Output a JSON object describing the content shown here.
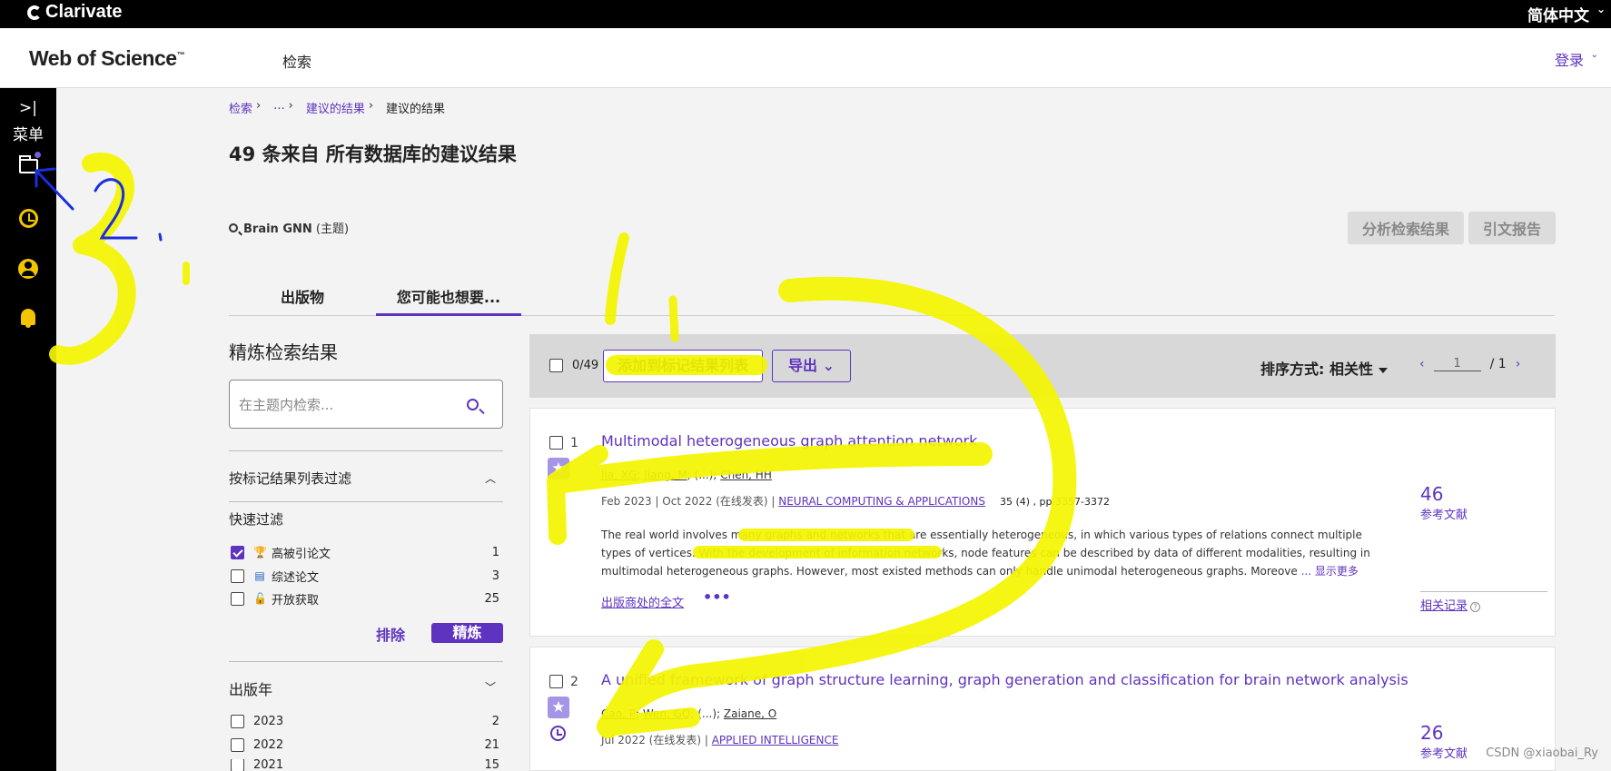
{
  "topbar": {
    "brand": "Clarivate",
    "language": "简体中文"
  },
  "header": {
    "product": "Web of Science",
    "trademark": "™",
    "nav_search": "检索",
    "login": "登录"
  },
  "sidenav": {
    "menu_toggle": ">|",
    "menu_label": "菜单"
  },
  "breadcrumb": {
    "items": [
      "检索",
      "...",
      "建议的结果"
    ],
    "current": "建议的结果"
  },
  "page_title": "49 条来自 所有数据库的建议结果",
  "query": {
    "term": "Brain GNN",
    "field": "(主题)"
  },
  "actions": {
    "analyze": "分析检索结果",
    "citation_report": "引文报告"
  },
  "tabs": [
    {
      "label": "出版物"
    },
    {
      "label": "您可能也想要..."
    }
  ],
  "refine": {
    "title": "精炼检索结果",
    "search_placeholder": "在主题内检索...",
    "marked_filter": "按标记结果列表过滤",
    "quick_filter_title": "快速过滤",
    "quick_filters": [
      {
        "label": "高被引论文",
        "count": "1",
        "checked": true,
        "icon": "trophy-icon"
      },
      {
        "label": "综述论文",
        "count": "3",
        "checked": false,
        "icon": "document-icon"
      },
      {
        "label": "开放获取",
        "count": "25",
        "checked": false,
        "icon": "unlock-icon"
      }
    ],
    "exclude": "排除",
    "refine_btn": "精炼",
    "pub_year_title": "出版年",
    "pub_years": [
      {
        "year": "2023",
        "count": "2"
      },
      {
        "year": "2022",
        "count": "21"
      },
      {
        "year": "2021",
        "count": "15"
      }
    ]
  },
  "toolbar": {
    "selected": "0/49",
    "add_marked": "添加到标记结果列表",
    "export": "导出",
    "sort": "排序方式: 相关性",
    "page": "1",
    "total_pages": "/ 1"
  },
  "results": [
    {
      "num": "1",
      "title": "Multimodal heterogeneous graph attention network",
      "authors": [
        "Jia, XG",
        "Jiang, M",
        "(...)",
        "Chen, HH"
      ],
      "date": "Feb 2023 | Oct 2022 (在线发表) |",
      "journal": "NEURAL COMPUTING & APPLICATIONS",
      "volume": "35 (4) , pp.3357-3372",
      "abstract": "The real world involves many graphs and networks that are essentially heterogeneous, in which various types of relations connect multiple types of vertices. With the development of information networks, node features can be described by data of different modalities, resulting in multimodal heterogeneous graphs. However, most existed methods can only handle unimodal heterogeneous graphs. Moreove",
      "show_more": "... 显示更多",
      "full_text": "出版商处的全文",
      "more": "•••",
      "refs_count": "46",
      "refs_label": "参考文献",
      "related": "相关记录",
      "help": "?"
    },
    {
      "num": "2",
      "title": "A unified framework of graph structure learning, graph generation and classification for brain network analysis",
      "authors": [
        "Cao, P",
        "Wen, GQ",
        "(...)",
        "Zaiane, O"
      ],
      "date": "Jul 2022 (在线发表) |",
      "journal": "APPLIED INTELLIGENCE",
      "refs_count": "26",
      "refs_label": "参考文献"
    }
  ],
  "watermark": "CSDN @xiaobai_Ry",
  "colors": {
    "accent": "#5e33bf",
    "highlight": "#f5f500",
    "annotation_blue": "#1a2ee0"
  }
}
